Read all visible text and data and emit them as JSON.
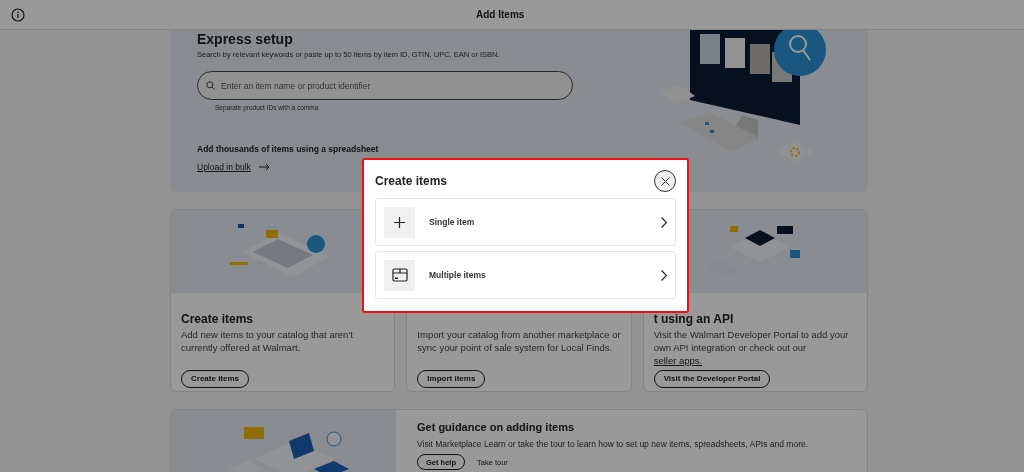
{
  "header": {
    "title": "Add Items"
  },
  "express_setup": {
    "title": "Express setup",
    "description": "Search by relevant keywords or paste up to 50 items by item ID, GTIN, UPC, EAN or ISBN.",
    "search": {
      "placeholder": "Enter an item name or product identifier"
    },
    "hint": "Separate product IDs with a comma",
    "bulk_heading": "Add thousands of items using a spreadsheet",
    "bulk_link": "Upload in bulk"
  },
  "cards": [
    {
      "title": "Create items",
      "description": "Add new items to your catalog that aren't currently offered at Walmart.",
      "button": "Create items"
    },
    {
      "description": "Import your catalog from another marketplace or sync your point of sale system for Local Finds.",
      "button": "Import items"
    },
    {
      "title": "t using an API",
      "description": "Visit the Walmart Developer Portal to add your own API integration or check out our",
      "link": "seller apps.",
      "button": "Visit the Developer Portal"
    }
  ],
  "guidance": {
    "title": "Get guidance on adding items",
    "description": "Visit Marketplace Learn or take the tour to learn how to set up new items, spreadsheets, APIs and more.",
    "buttons": [
      {
        "label": "Get help",
        "kind": "outline"
      },
      {
        "label": "Take tour",
        "kind": "text"
      }
    ]
  },
  "modal": {
    "title": "Create items",
    "options": [
      {
        "label": "Single item",
        "kind": "plus"
      },
      {
        "label": "Multiple items",
        "kind": "box"
      }
    ]
  }
}
